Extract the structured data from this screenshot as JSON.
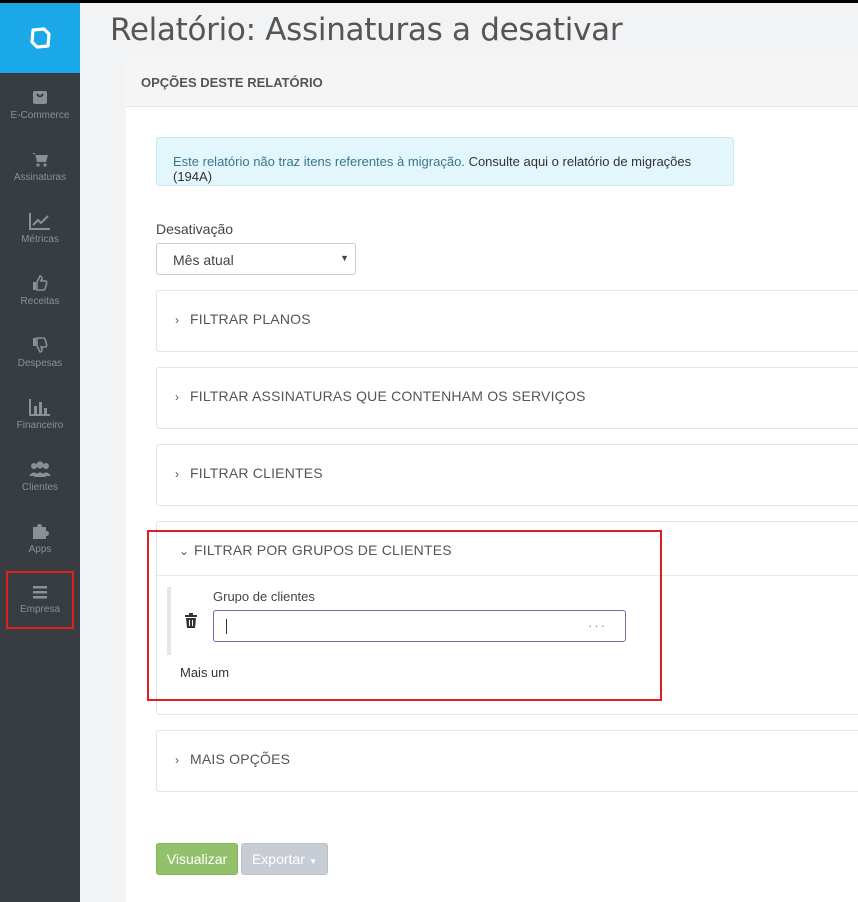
{
  "title": "Relatório: Assinaturas a desativar",
  "sidebar": {
    "items": [
      {
        "label": "E-Commerce",
        "icon": "shopping-bag-icon"
      },
      {
        "label": "Assinaturas",
        "icon": "cart-icon"
      },
      {
        "label": "Métricas",
        "icon": "line-chart-icon"
      },
      {
        "label": "Receitas",
        "icon": "thumbs-up-icon"
      },
      {
        "label": "Despesas",
        "icon": "thumbs-down-icon"
      },
      {
        "label": "Financeiro",
        "icon": "bar-chart-icon"
      },
      {
        "label": "Clientes",
        "icon": "users-icon"
      },
      {
        "label": "Apps",
        "icon": "puzzle-icon"
      },
      {
        "label": "Empresa",
        "icon": "menu-icon"
      }
    ]
  },
  "panel": {
    "header": "OPÇÕES DESTE RELATÓRIO",
    "info_text": "Este relatório não traz itens referentes à migração.",
    "info_link": "Consulte aqui o relatório de migrações (194A)",
    "desativacao_label": "Desativação",
    "desativacao_value": "Mês atual",
    "filters": {
      "planos": "FILTRAR PLANOS",
      "servicos": "FILTRAR ASSINATURAS QUE CONTENHAM OS SERVIÇOS",
      "clientes": "FILTRAR CLIENTES",
      "grupos": "FILTRAR POR GRUPOS DE CLIENTES",
      "mais": "MAIS OPÇÕES"
    },
    "grupo_label": "Grupo de clientes",
    "grupo_dots": "···",
    "mais_um": "Mais um",
    "btn_visualizar": "Visualizar",
    "btn_exportar": "Exportar"
  },
  "colors": {
    "sidebar": "#373d41",
    "logo": "#1ba8e8",
    "info_bg": "#e3f6fb",
    "visualizar": "#93c06a",
    "exportar": "#c7ccd5",
    "highlight": "#e02020"
  }
}
